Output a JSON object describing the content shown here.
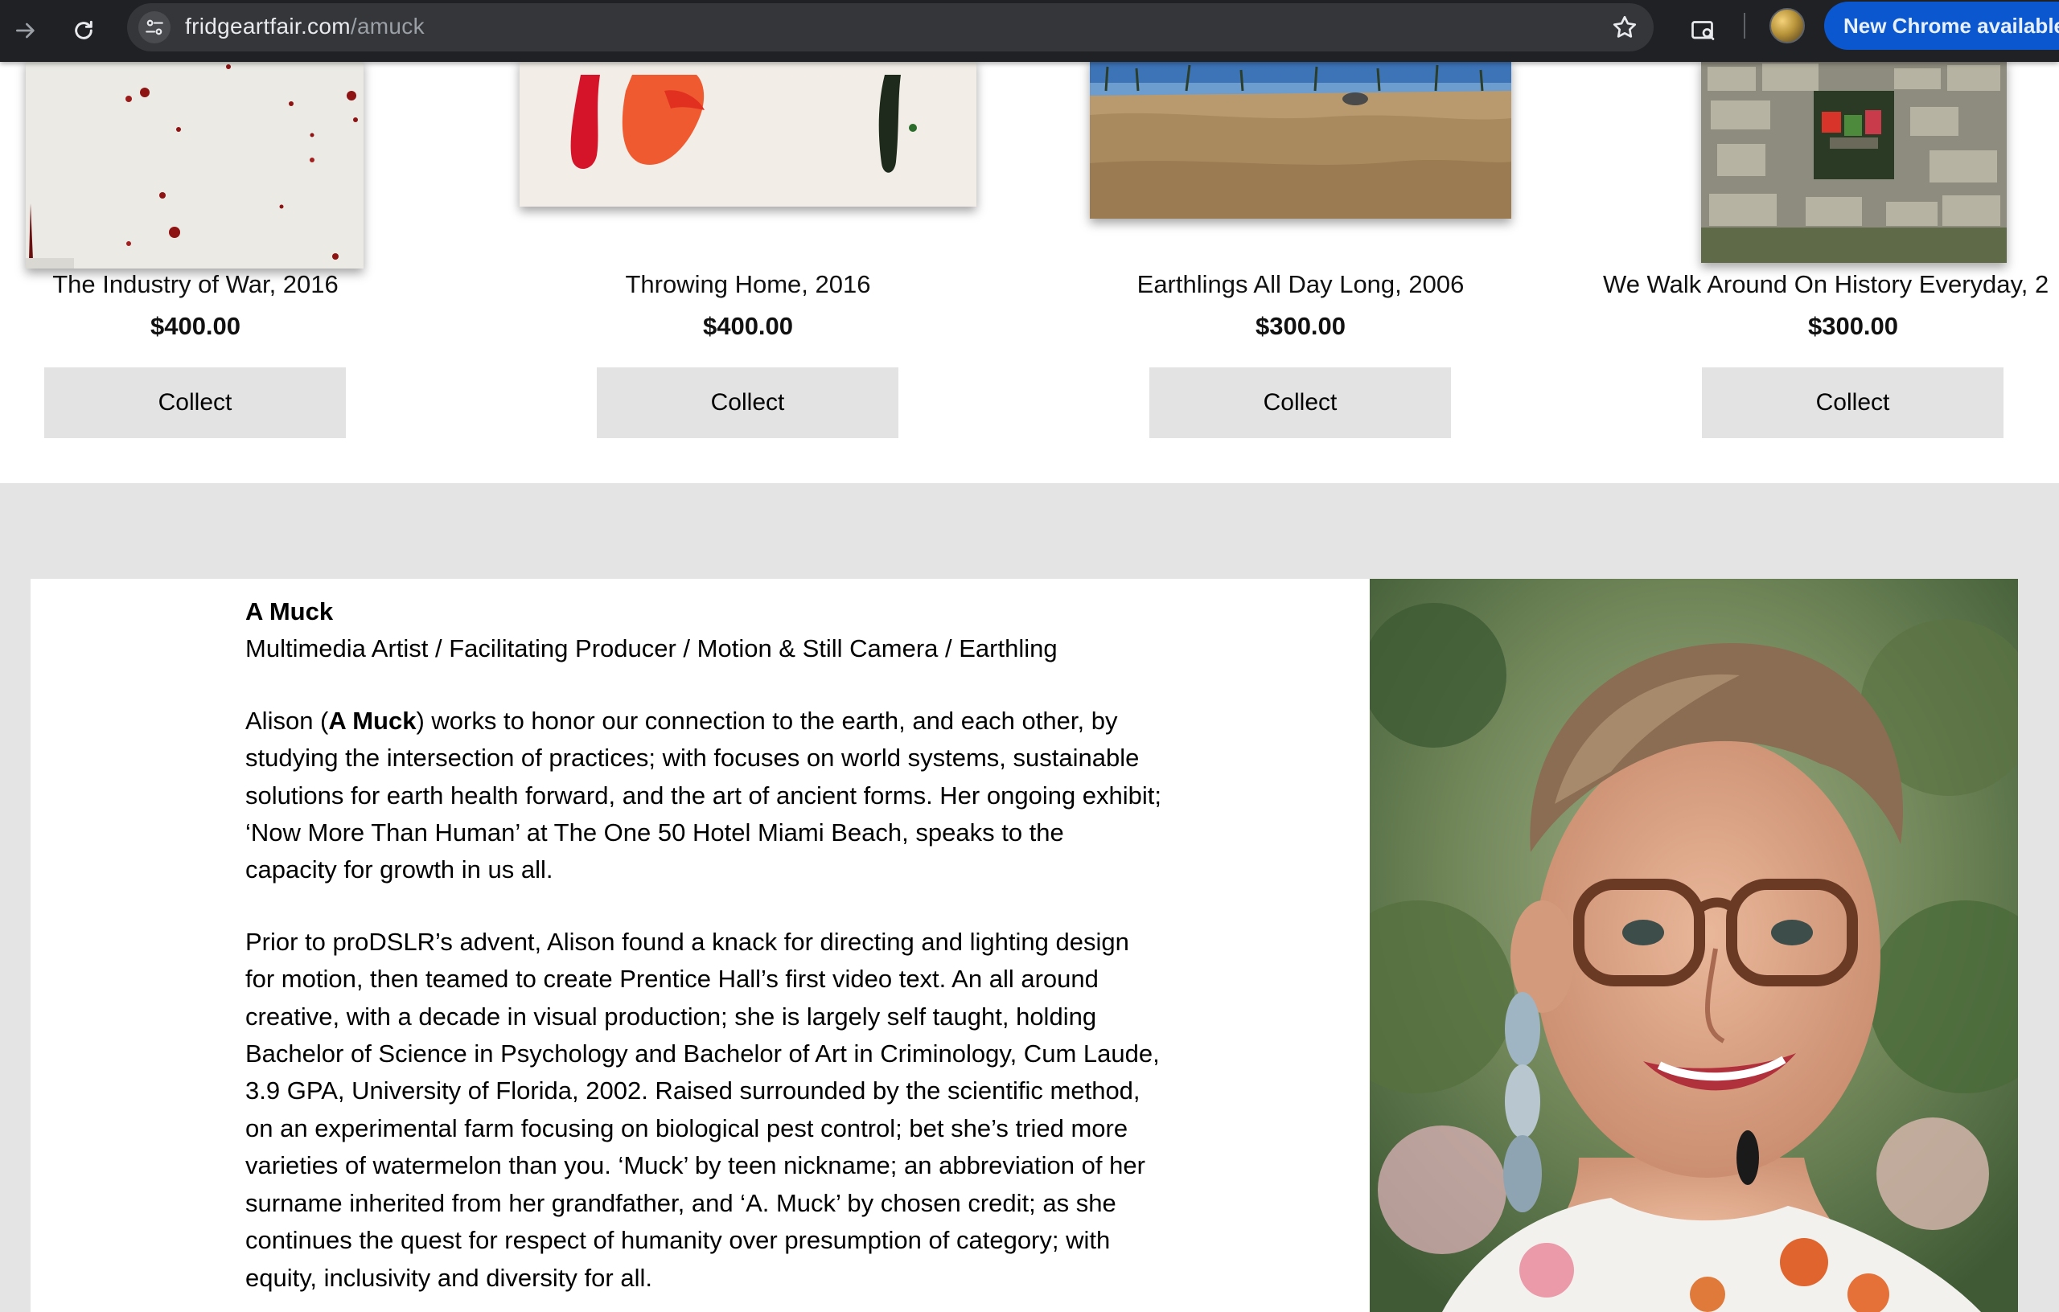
{
  "browser": {
    "url_domain": "fridgeartfair.com",
    "url_path": "/amuck",
    "update_button_label": "New Chrome available"
  },
  "products": [
    {
      "title": "The Industry of War, 2016",
      "price": "$400.00",
      "button_label": "Collect"
    },
    {
      "title": "Throwing Home, 2016",
      "price": "$400.00",
      "button_label": "Collect"
    },
    {
      "title": "Earthlings All Day Long, 2006",
      "price": "$300.00",
      "button_label": "Collect"
    },
    {
      "title": "We Walk Around On History Everyday, 2",
      "price": "$300.00",
      "button_label": "Collect"
    }
  ],
  "about": {
    "name": "A Muck",
    "role": "Multimedia Artist / Facilitating Producer / Motion & Still Camera / Earthling",
    "bio_1_prefix": "Alison (",
    "bio_1_bold": "A Muck",
    "bio_1_rest": ") works to honor our connection to the earth, and each other, by studying the intersection of practices; with focuses on world systems, sustainable solutions for earth health forward, and the art of ancient forms. Her ongoing exhibit; ‘Now More Than Human’ at The One 50 Hotel Miami Beach, speaks to the capacity for growth in us all.",
    "bio_2": "Prior to proDSLR’s advent, Alison found a knack for directing and lighting design for motion, then teamed to create Prentice Hall’s first video text. An all around creative, with a decade in visual production; she is largely self taught, holding Bachelor of Science in Psychology and Bachelor of Art in Criminology, Cum Laude, 3.9 GPA, University of Florida, 2002. Raised surrounded by the scientific method, on an experimental farm focusing on biological pest control; bet she’s tried more varieties of watermelon than you. ‘Muck’ by teen nickname; an abbreviation of her surname inherited from her grandfather, and ‘A. Muck’ by chosen credit; as she continues the quest for respect of humanity over presumption of category; with equity, inclusivity and diversity for all."
  }
}
